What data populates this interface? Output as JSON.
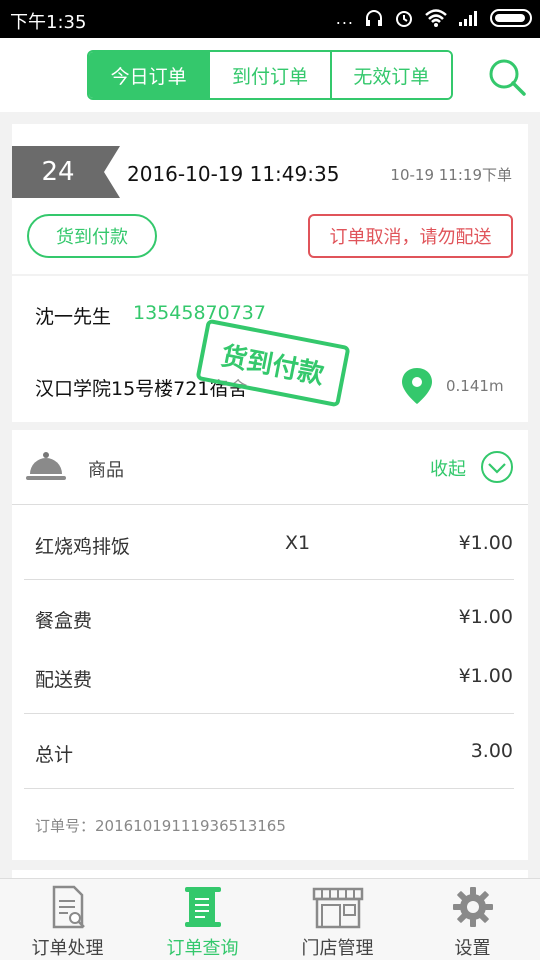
{
  "status_bar": {
    "time": "下午1:35",
    "dots": "..."
  },
  "header": {
    "tabs": [
      {
        "label": "今日订单",
        "active": true
      },
      {
        "label": "到付订单",
        "active": false
      },
      {
        "label": "无效订单",
        "active": false
      }
    ]
  },
  "order": {
    "number": "24",
    "time": "2016-10-19 11:49:35",
    "placed": "10-19 11:19下单",
    "payment_tag": "货到付款",
    "cancel_notice": "订单取消，请勿配送",
    "customer_name": "沈一先生",
    "customer_phone": "13545870737",
    "address": "汉口学院15号楼721宿舍",
    "distance": "0.141m",
    "stamp": "货到付款",
    "goods_label": "商品",
    "collapse_label": "收起",
    "items": [
      {
        "name": "红烧鸡排饭",
        "qty": "X1",
        "price": "¥1.00"
      }
    ],
    "fees": [
      {
        "label": "餐盒费",
        "value": "¥1.00"
      },
      {
        "label": "配送费",
        "value": "¥1.00"
      }
    ],
    "total_label": "总计",
    "total_value": "3.00",
    "order_no": "订单号：20161019111936513165"
  },
  "bottom_nav": [
    {
      "label": "订单处理",
      "icon": "order-process-icon",
      "active": false
    },
    {
      "label": "订单查询",
      "icon": "order-query-icon",
      "active": true
    },
    {
      "label": "门店管理",
      "icon": "store-icon",
      "active": false
    },
    {
      "label": "设置",
      "icon": "gear-icon",
      "active": false
    }
  ],
  "colors": {
    "accent": "#34c86c",
    "danger": "#e0545a",
    "tag_gray": "#6b6b6b"
  }
}
